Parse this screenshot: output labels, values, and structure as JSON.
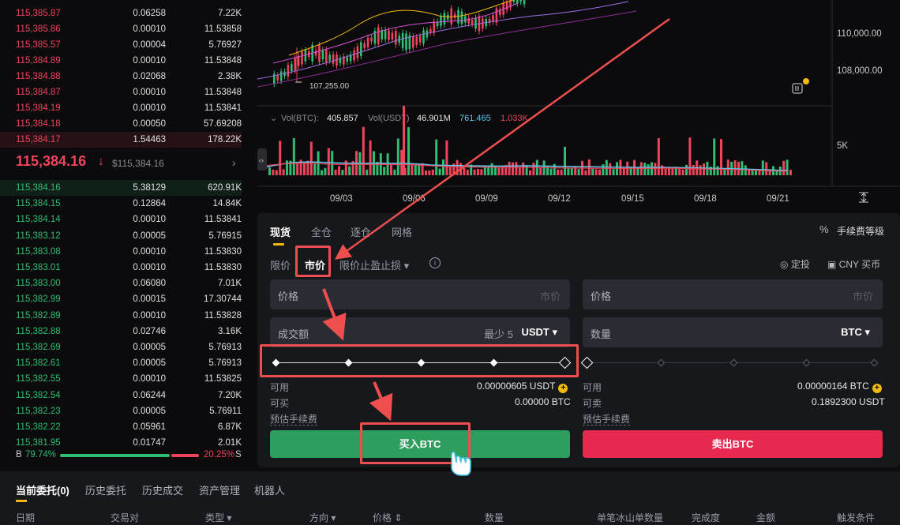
{
  "orderbook": {
    "asks": [
      {
        "price": "115,385.87",
        "qty": "0.06258",
        "total": "7.22K"
      },
      {
        "price": "115,385.86",
        "qty": "0.00010",
        "total": "11.53858"
      },
      {
        "price": "115,385.57",
        "qty": "0.00004",
        "total": "5.76927"
      },
      {
        "price": "115,384.89",
        "qty": "0.00010",
        "total": "11.53848"
      },
      {
        "price": "115,384.88",
        "qty": "0.02068",
        "total": "2.38K"
      },
      {
        "price": "115,384.87",
        "qty": "0.00010",
        "total": "11.53848"
      },
      {
        "price": "115,384.19",
        "qty": "0.00010",
        "total": "11.53841"
      },
      {
        "price": "115,384.18",
        "qty": "0.00050",
        "total": "57.69208"
      },
      {
        "price": "115,384.17",
        "qty": "1.54463",
        "total": "178.22K"
      }
    ],
    "mid_price": "115,384.16",
    "mid_arrow": "↓",
    "mid_usd": "$115,384.16",
    "mid_chevron": "›",
    "bids": [
      {
        "price": "115,384.16",
        "qty": "5.38129",
        "total": "620.91K"
      },
      {
        "price": "115,384.15",
        "qty": "0.12864",
        "total": "14.84K"
      },
      {
        "price": "115,384.14",
        "qty": "0.00010",
        "total": "11.53841"
      },
      {
        "price": "115,383.12",
        "qty": "0.00005",
        "total": "5.76915"
      },
      {
        "price": "115,383.08",
        "qty": "0.00010",
        "total": "11.53830"
      },
      {
        "price": "115,383.01",
        "qty": "0.00010",
        "total": "11.53830"
      },
      {
        "price": "115,383.00",
        "qty": "0.06080",
        "total": "7.01K"
      },
      {
        "price": "115,382.99",
        "qty": "0.00015",
        "total": "17.30744"
      },
      {
        "price": "115,382.89",
        "qty": "0.00010",
        "total": "11.53828"
      },
      {
        "price": "115,382.88",
        "qty": "0.02746",
        "total": "3.16K"
      },
      {
        "price": "115,382.69",
        "qty": "0.00005",
        "total": "5.76913"
      },
      {
        "price": "115,382.61",
        "qty": "0.00005",
        "total": "5.76913"
      },
      {
        "price": "115,382.55",
        "qty": "0.00010",
        "total": "11.53825"
      },
      {
        "price": "115,382.54",
        "qty": "0.06244",
        "total": "7.20K"
      },
      {
        "price": "115,382.23",
        "qty": "0.00005",
        "total": "5.76911"
      },
      {
        "price": "115,382.22",
        "qty": "0.05961",
        "total": "6.87K"
      },
      {
        "price": "115,381.95",
        "qty": "0.01747",
        "total": "2.01K"
      }
    ],
    "ratio": {
      "b_label": "B",
      "b_value": "79.74%",
      "s_value": "20.25%",
      "s_label": "S",
      "buy_fraction": 0.7974
    }
  },
  "chart": {
    "low_label": "107,255.00",
    "price_ticks": [
      "110,000.00",
      "108,000.00"
    ],
    "vol_line": {
      "label1": "Vol(BTC):",
      "value1": "405.857",
      "label2": "Vol(USDT)",
      "value2": "46.901M",
      "value3": "761.465",
      "value4": "1.033K"
    },
    "vol_tick": "5K",
    "dates": [
      "09/03",
      "09/06",
      "09/09",
      "09/12",
      "09/15",
      "09/18",
      "09/21"
    ]
  },
  "trade": {
    "tabs": [
      "现货",
      "全仓",
      "逐仓",
      "网格"
    ],
    "fee_icon": "%",
    "fee_label": "手续费等级",
    "order_types": [
      "限价",
      "市价",
      "限价止盈止损 ▾"
    ],
    "info_icon": "i",
    "dingtou": "定投",
    "cny_buy": "CNY 买币",
    "buy": {
      "price_label": "价格",
      "price_placeholder": "市价",
      "amount_label": "成交额",
      "amount_min": "最少 5",
      "amount_unit": "USDT ▾",
      "avail_label": "可用",
      "avail_value": "0.00000605 USDT",
      "canbuy_label": "可买",
      "canbuy_value": "0.00000 BTC",
      "fee_label": "预估手续费",
      "button": "买入BTC"
    },
    "sell": {
      "price_label": "价格",
      "price_placeholder": "市价",
      "qty_label": "数量",
      "qty_unit": "BTC ▾",
      "avail_label": "可用",
      "avail_value": "0.00000164 BTC",
      "cansell_label": "可卖",
      "cansell_value": "0.1892300 USDT",
      "fee_label": "预估手续费",
      "button": "卖出BTC"
    },
    "coin_glyph": "+"
  },
  "bottom": {
    "tabs": [
      "当前委托(0)",
      "历史委托",
      "历史成交",
      "资产管理",
      "机器人"
    ],
    "columns": [
      "日期",
      "交易对",
      "类型 ▾",
      "方向 ▾",
      "价格 ⇕",
      "数量",
      "单笔冰山单数量",
      "完成度",
      "金额",
      "触发条件"
    ]
  },
  "colors": {
    "ask": "#f0435c",
    "bid": "#2fbd72",
    "accent": "#f0b90b",
    "buy_button": "#2e9e5e",
    "sell_button": "#e8294f",
    "annotation": "#ef4e4e"
  }
}
